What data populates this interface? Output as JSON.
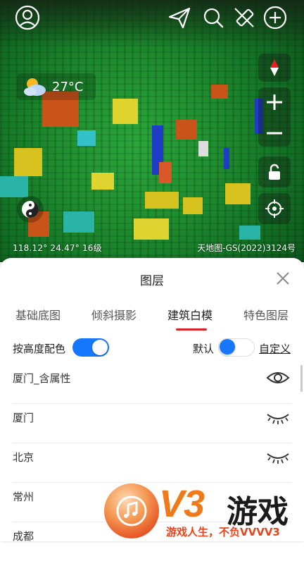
{
  "map": {
    "weather_temp": "27°C",
    "coords": "118.12° 24.47° 16级",
    "attribution": "天地图-GS(2022)3124号"
  },
  "icons": {
    "top_left": "user-icon",
    "top_right": [
      "send-icon",
      "search-icon",
      "measure-icon",
      "add-icon"
    ],
    "right": [
      "compass-icon",
      "zoom-in-icon",
      "zoom-out-icon",
      "lock-icon",
      "locate-icon"
    ],
    "left": "yin-yang-icon"
  },
  "panel": {
    "title": "图层",
    "tabs": [
      "基础底图",
      "倾斜摄影",
      "建筑白模",
      "特色图层"
    ],
    "active_tab": "建筑白模",
    "height_color_label": "按高度配色",
    "height_color_on": true,
    "default_label": "默认",
    "default_on": false,
    "custom_label": "自定义",
    "layers": [
      {
        "name": "厦门_含属性",
        "visible": true
      },
      {
        "name": "厦门",
        "visible": false
      },
      {
        "name": "北京",
        "visible": false
      },
      {
        "name": "常州",
        "visible": false
      },
      {
        "name": "成都",
        "visible": false
      }
    ]
  },
  "watermark": {
    "brand": "V3",
    "brand_cn": "游戏",
    "slogan": "游戏人生，不负VVVV3"
  },
  "colors": {
    "accent_blue": "#1677ff",
    "tab_underline": "#d6232b",
    "watermark_orange": "#f07a1a"
  }
}
